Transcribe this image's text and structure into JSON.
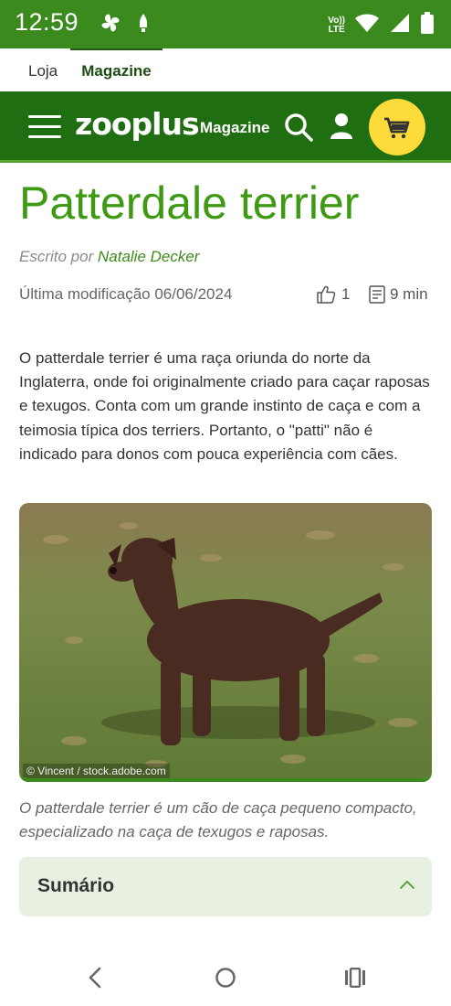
{
  "status_bar": {
    "time": "12:59",
    "network_label_top": "Vo))",
    "network_label_bottom": "LTE",
    "icons": [
      "pinwheel-icon",
      "notification-icon",
      "wifi-icon",
      "signal-icon",
      "battery-icon"
    ]
  },
  "top_tabs": {
    "tab1": "Loja",
    "tab2": "Magazine"
  },
  "header": {
    "logo": "zooplus",
    "logo_sub": "Magazine",
    "brand_color": "#1f6e12",
    "cart_color": "#fddb3a",
    "icons": [
      "menu-icon",
      "search-icon",
      "user-icon",
      "cart-icon"
    ]
  },
  "article": {
    "title": "Patterdale terrier",
    "byline_prefix": "Escrito por",
    "author": "Natalie Decker",
    "updated": "Última modificação 06/06/2024",
    "likes": "1",
    "read_time": "9 min",
    "intro": "O patterdale terrier é uma raça oriunda do norte da Inglaterra, onde foi originalmente criado para caçar raposas e texugos. Conta com um grande instinto de caça e com a teimosia típica dos terriers. Portanto, o \"patti\" não é indicado para donos com pouca experiência com cães.",
    "photo_credit": "© Vincent / stock.adobe.com",
    "caption": "O patterdale terrier é um cão de caça pequeno compacto, especializado na caça de texugos e raposas.",
    "title_color": "#3e9a13"
  },
  "summary": {
    "label": "Sumário"
  },
  "nav_bar": {
    "icons": [
      "back-icon",
      "home-icon",
      "recents-icon"
    ]
  }
}
